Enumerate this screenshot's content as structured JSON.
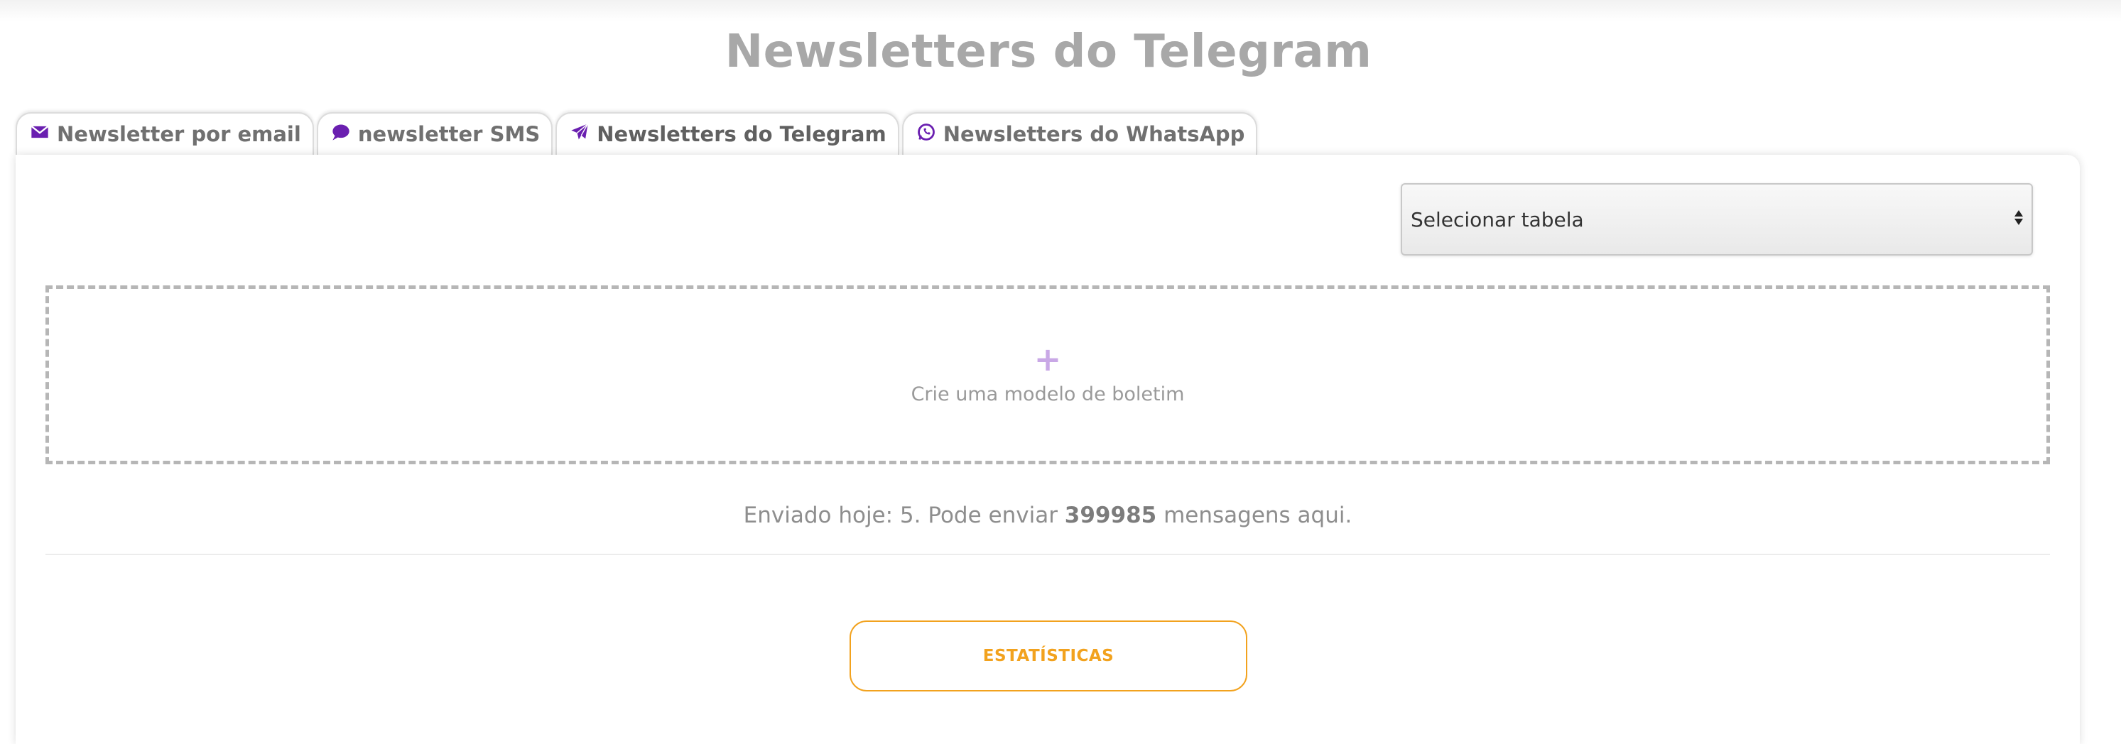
{
  "page": {
    "title": "Newsletters do Telegram"
  },
  "tabs": [
    {
      "label": "Newsletter por email",
      "icon": "envelope-icon"
    },
    {
      "label": "newsletter SMS",
      "icon": "chat-bubble-icon"
    },
    {
      "label": "Newsletters do Telegram",
      "icon": "paper-plane-icon",
      "active": true
    },
    {
      "label": "Newsletters do WhatsApp",
      "icon": "whatsapp-icon"
    }
  ],
  "table_select": {
    "value": "Selecionar tabela"
  },
  "template": {
    "plus": "+",
    "label": "Crie uma modelo de boletim"
  },
  "sent_info": {
    "prefix": "Enviado hoje: 5. Pode enviar",
    "count": "399985",
    "suffix": "mensagens aqui."
  },
  "stats_button": {
    "label": "ESTATÍSTICAS"
  },
  "colors": {
    "accent_purple": "#6a1fb0",
    "accent_orange": "#f2a21e",
    "title_gray": "#a8a8a8"
  }
}
